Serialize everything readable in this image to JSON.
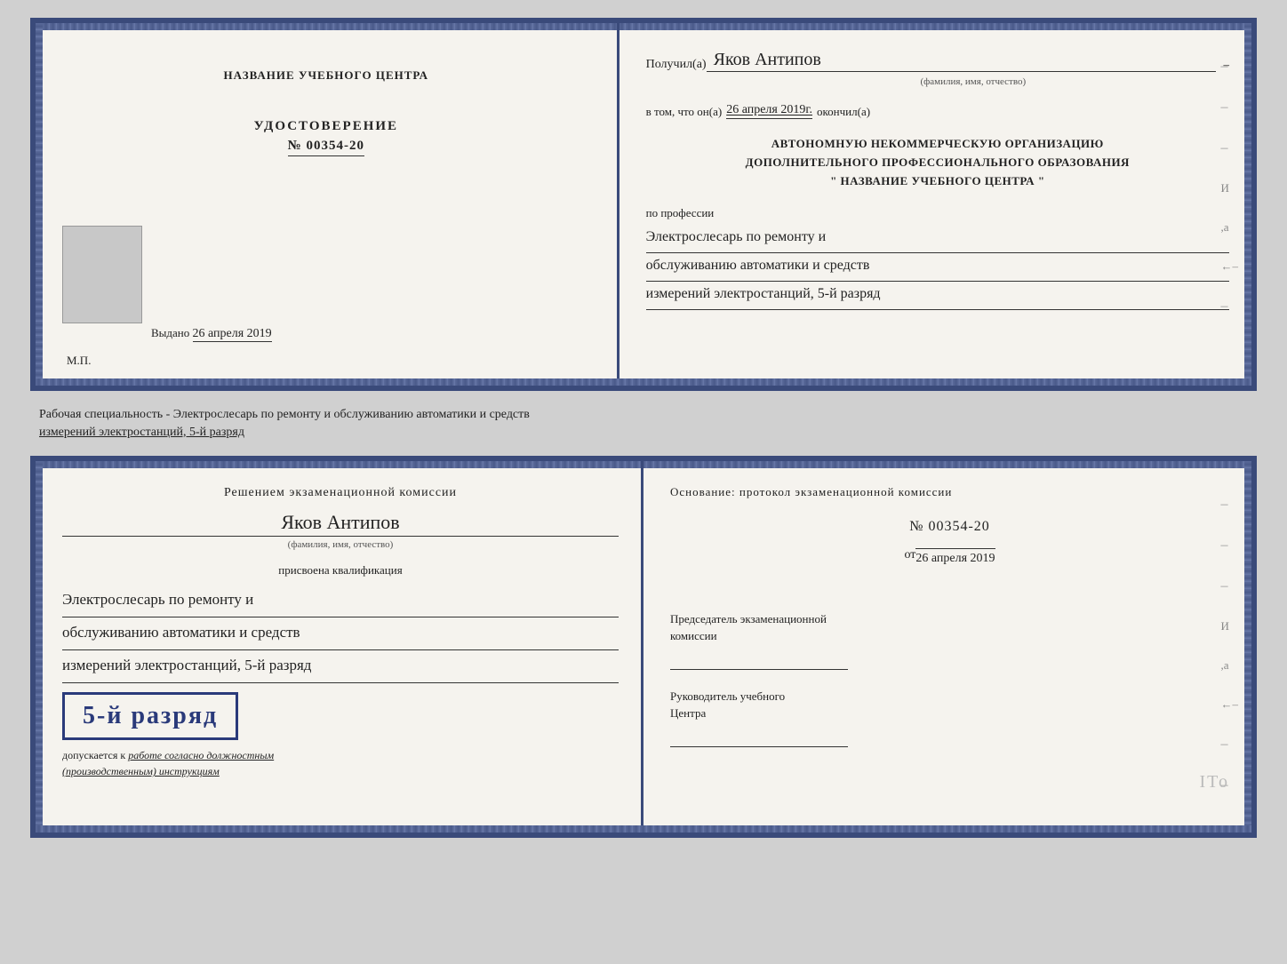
{
  "top_book": {
    "left": {
      "center_title": "НАЗВАНИЕ УЧЕБНОГО ЦЕНТРА",
      "cert_label": "УДОСТОВЕРЕНИЕ",
      "cert_number": "№ 00354-20",
      "issued_prefix": "Выдано",
      "issued_date": "26 апреля 2019",
      "mp_label": "М.П."
    },
    "right": {
      "recipient_prefix": "Получил(а)",
      "recipient_name": "Яков Антипов",
      "recipient_sub": "(фамилия, имя, отчество)",
      "statement_prefix": "в том, что он(а)",
      "statement_date": "26 апреля 2019г.",
      "statement_suffix": "окончил(а)",
      "org_line1": "АВТОНОМНУЮ НЕКОММЕРЧЕСКУЮ ОРГАНИЗАЦИЮ",
      "org_line2": "ДОПОЛНИТЕЛЬНОГО ПРОФЕССИОНАЛЬНОГО ОБРАЗОВАНИЯ",
      "org_line3": "\"  НАЗВАНИЕ УЧЕБНОГО ЦЕНТРА  \"",
      "profession_prefix": "по профессии",
      "profession_line1": "Электрослесарь по ремонту и",
      "profession_line2": "обслуживанию автоматики и средств",
      "profession_line3": "измерений электростанций, 5-й разряд"
    }
  },
  "separator": {
    "text_line1": "Рабочая специальность - Электрослесарь по ремонту и обслуживанию автоматики и средств",
    "text_line2_underlined": "измерений электростанций, 5-й разряд"
  },
  "bottom_book": {
    "left": {
      "commission_title": "Решением экзаменационной комиссии",
      "commission_name": "Яков Антипов",
      "sub_label": "(фамилия, имя, отчество)",
      "qualification_prefix": "присвоена квалификация",
      "qualification_line1": "Электрослесарь по ремонту и",
      "qualification_line2": "обслуживанию автоматики и средств",
      "qualification_line3": "измерений электростанций, 5-й разряд",
      "rank_badge": "5-й разряд",
      "допускается_text": "допускается к",
      "допускается_italic": "работе согласно должностным",
      "инструкциям_italic": "(производственным) инструкциям"
    },
    "right": {
      "basis_title": "Основание: протокол экзаменационной комиссии",
      "protocol_number": "№ 00354-20",
      "protocol_date_prefix": "от",
      "protocol_date": "26 апреля 2019",
      "chairman_label1": "Председатель экзаменационной",
      "chairman_label2": "комиссии",
      "director_label1": "Руководитель учебного",
      "director_label2": "Центра"
    },
    "side_marks": [
      "–",
      "–",
      "–",
      "И",
      ",а",
      "←",
      "–",
      "–",
      "–",
      "–"
    ]
  }
}
